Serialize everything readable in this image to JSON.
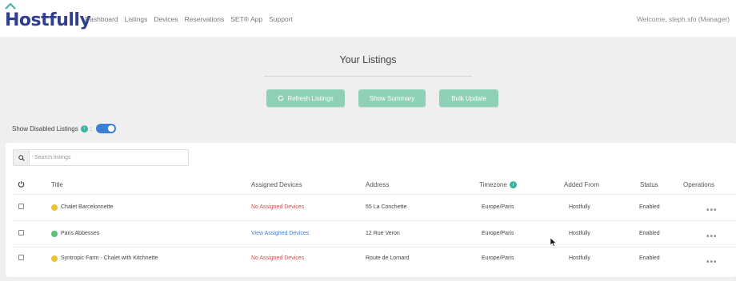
{
  "header": {
    "logo_text": "Hostfully",
    "nav": [
      "Dashboard",
      "Listings",
      "Devices",
      "Reservations",
      "SET® App",
      "Support"
    ],
    "welcome": "Welcome, steph.sfo (Manager)"
  },
  "page": {
    "title": "Your Listings",
    "buttons": {
      "refresh": "Refresh Listings",
      "summary": "Show Summary",
      "bulk": "Bulk Update"
    },
    "show_disabled_label": "Show Disabled Listings",
    "show_disabled_badge": "i",
    "show_disabled_colon": ":",
    "show_disabled_on": true
  },
  "search": {
    "placeholder": "Search listings",
    "value": ""
  },
  "table": {
    "columns": [
      "Title",
      "Assigned Devices",
      "Address",
      "Timezone",
      "Added From",
      "Status",
      "Operations"
    ],
    "timezone_badge": "i",
    "rows": [
      {
        "title": "Chalet Barcelonnette",
        "dot_color": "#e8c53a",
        "devices": "No Assigned Devices",
        "devices_color": "#d14b4b",
        "address": "55 La Conchette",
        "timezone": "Europe/Paris",
        "added_from": "Hostfully",
        "status": "Enabled",
        "ops": "•••"
      },
      {
        "title": "Paris Abbesses",
        "dot_color": "#5cc27a",
        "devices": "View Assigned Devices",
        "devices_color": "#3f7fc9",
        "address": "12 Rue Veron",
        "timezone": "Europe/Paris",
        "added_from": "Hostfully",
        "status": "Enabled",
        "ops": "•••"
      },
      {
        "title": "Syntropic Farm - Chalet with Kitchnette",
        "dot_color": "#e8c53a",
        "devices": "No Assigned Devices",
        "devices_color": "#d14b4b",
        "address": "Route de Lornard",
        "timezone": "Europe/Paris",
        "added_from": "Hostfully",
        "status": "Enabled",
        "ops": "•••"
      }
    ]
  },
  "colors": {
    "brand": "#2e3f8f",
    "button": "#8fd1b6",
    "toggle": "#3d7fd4",
    "badge": "#3ab3a5"
  }
}
